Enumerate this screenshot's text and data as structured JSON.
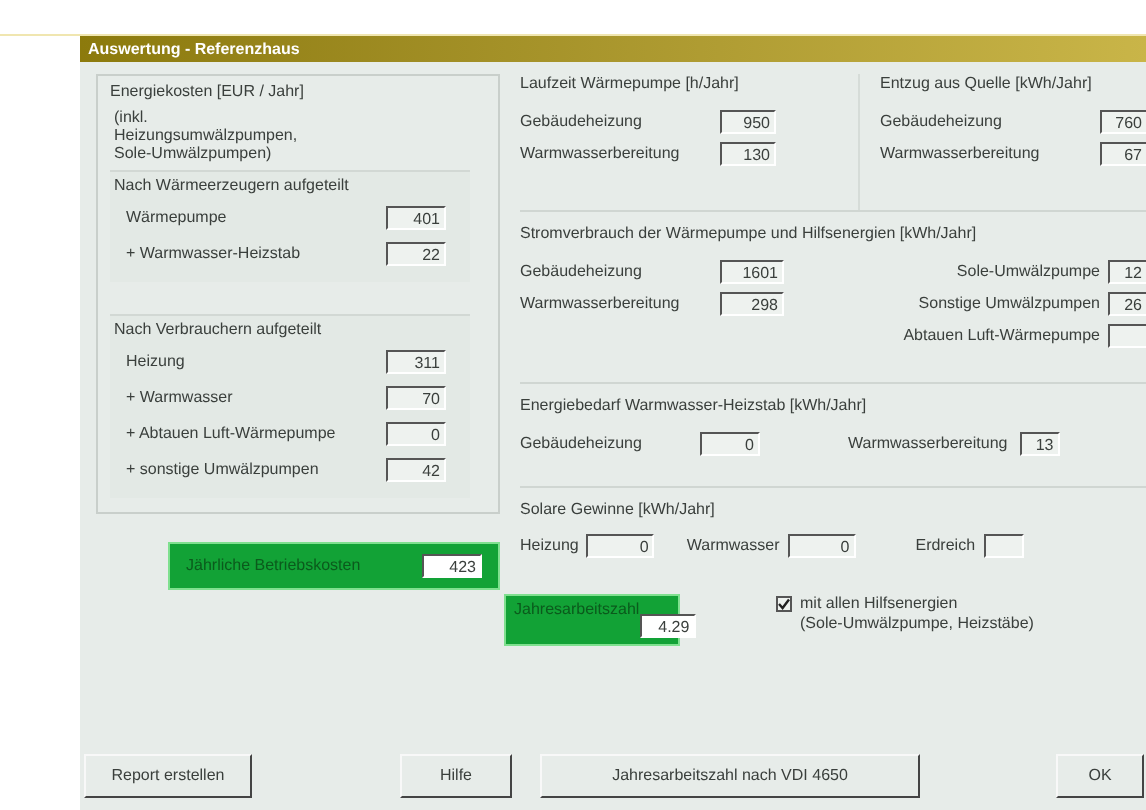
{
  "window": {
    "title": "Auswertung - Referenzhaus"
  },
  "energy_costs": {
    "title": "Energiekosten [EUR / Jahr]",
    "note": "(inkl. Heizungsumwälzpumpen, Sole-Umwälzpumpen)",
    "by_generator": {
      "title": "Nach Wärmeerzeugern aufgeteilt",
      "rows": [
        {
          "label": "Wärmepumpe",
          "value": "401"
        },
        {
          "label": "+ Warmwasser-Heizstab",
          "value": "22"
        }
      ]
    },
    "by_consumer": {
      "title": "Nach Verbrauchern aufgeteilt",
      "rows": [
        {
          "label": "Heizung",
          "value": "311"
        },
        {
          "label": "+ Warmwasser",
          "value": "70"
        },
        {
          "label": "+ Abtauen Luft-Wärmepumpe",
          "value": "0"
        },
        {
          "label": "+ sonstige Umwälzpumpen",
          "value": "42"
        }
      ]
    },
    "total": {
      "label": "Jährliche Betriebskosten",
      "value": "423"
    }
  },
  "runtime": {
    "title": "Laufzeit Wärmepumpe [h/Jahr]",
    "rows": [
      {
        "label": "Gebäudeheizung",
        "value": "950"
      },
      {
        "label": "Warmwasserbereitung",
        "value": "130"
      }
    ]
  },
  "source_extraction": {
    "title": "Entzug aus Quelle [kWh/Jahr]",
    "rows": [
      {
        "label": "Gebäudeheizung",
        "value": "760"
      },
      {
        "label": "Warmwasserbereitung",
        "value": "67"
      }
    ]
  },
  "power_consumption": {
    "title": "Stromverbrauch der Wärmepumpe und Hilfsenergien [kWh/Jahr]",
    "left_rows": [
      {
        "label": "Gebäudeheizung",
        "value": "1601"
      },
      {
        "label": "Warmwasserbereitung",
        "value": "298"
      }
    ],
    "right_rows": [
      {
        "label": "Sole-Umwälzpumpe",
        "value": "12"
      },
      {
        "label": "Sonstige Umwälzpumpen",
        "value": "26"
      },
      {
        "label": "Abtauen Luft-Wärmepumpe"
      }
    ]
  },
  "heater_demand": {
    "title": "Energiebedarf Warmwasser-Heizstab [kWh/Jahr]",
    "rows": [
      {
        "label": "Gebäudeheizung",
        "value": "0"
      },
      {
        "label": "Warmwasserbereitung",
        "value": "13"
      }
    ]
  },
  "solar_gains": {
    "title": "Solare Gewinne [kWh/Jahr]",
    "rows": [
      {
        "label": "Heizung",
        "value": "0"
      },
      {
        "label": "Warmwasser",
        "value": "0"
      },
      {
        "label": "Erdreich"
      }
    ]
  },
  "annual_performance": {
    "label": "Jahresarbeitszahl",
    "value": "4.29"
  },
  "auxiliary_option": {
    "label": "mit allen Hilfsenergien\n(Sole-Umwälzpumpe, Heizstäbe)",
    "checked": true
  },
  "buttons": [
    {
      "label": "Report erstellen"
    },
    {
      "label": "Hilfe"
    },
    {
      "label": "Jahresarbeitszahl nach VDI 4650"
    },
    {
      "label": "OK"
    }
  ]
}
